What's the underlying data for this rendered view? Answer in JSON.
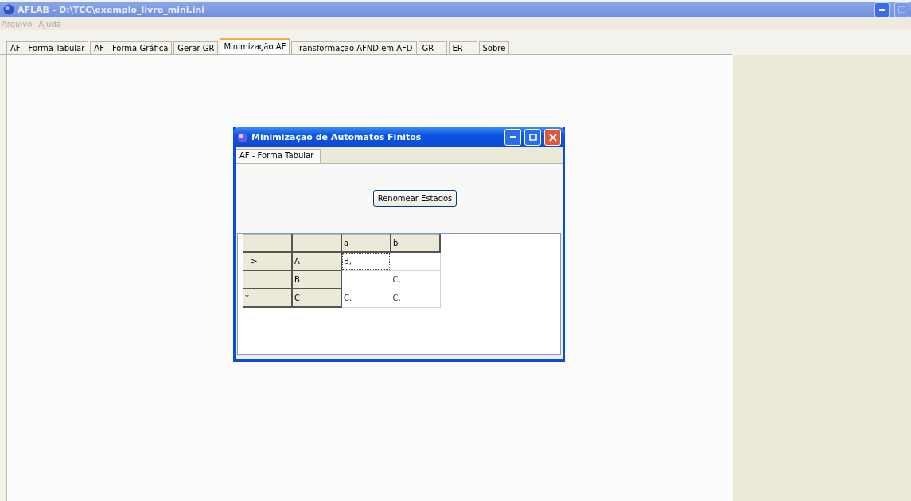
{
  "window": {
    "title": "AFLAB - D:\\TCC\\exemplo_livro_mini.ini"
  },
  "menu": [
    {
      "label": "Arquivo",
      "disabled": true
    },
    {
      "label": "Ajuda",
      "disabled": true
    }
  ],
  "tabs": [
    {
      "label": "AF - Forma Tabular",
      "selected": false
    },
    {
      "label": "AF - Forma Gráfica",
      "selected": false
    },
    {
      "label": "Gerar GR",
      "selected": false
    },
    {
      "label": "Minimização AF",
      "selected": true
    },
    {
      "label": "Transformação AFND em AFD",
      "selected": false
    },
    {
      "label": "GR",
      "selected": false
    },
    {
      "label": "ER",
      "selected": false
    },
    {
      "label": "Sobre",
      "selected": false
    }
  ],
  "dialog": {
    "title": "Minimização de Automatos Finitos",
    "tabs": [
      {
        "label": "AF - Forma Tabular",
        "selected": true
      }
    ],
    "button": "Renomear Estados",
    "table": {
      "columns": [
        "",
        "",
        "a",
        "b"
      ],
      "rows": [
        {
          "marker": "-->",
          "state": "A",
          "cells": [
            {
              "text": "B,",
              "selected": true
            },
            {
              "text": "",
              "selected": false
            }
          ]
        },
        {
          "marker": "",
          "state": "B",
          "cells": [
            {
              "text": "",
              "selected": false
            },
            {
              "text": "C,",
              "selected": false
            }
          ]
        },
        {
          "marker": "*",
          "state": "C",
          "cells": [
            {
              "text": "C,",
              "selected": false
            },
            {
              "text": "C,",
              "selected": false
            }
          ]
        }
      ]
    }
  }
}
